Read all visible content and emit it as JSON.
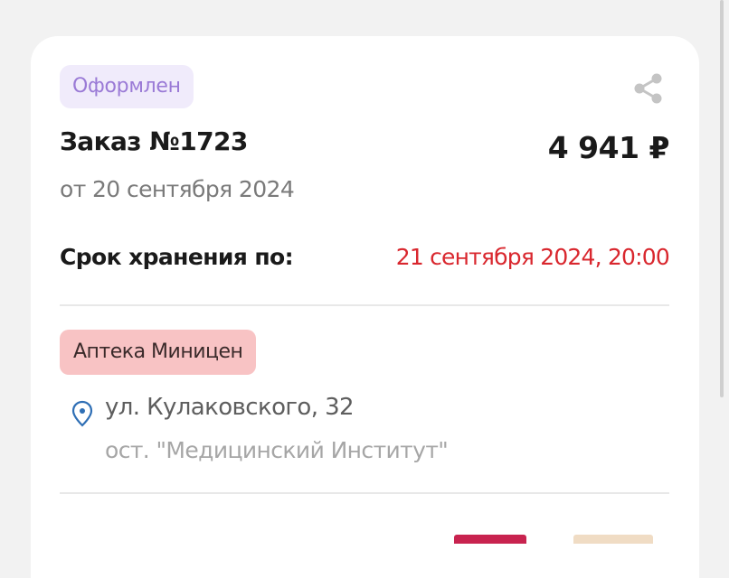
{
  "order": {
    "status": "Оформлен",
    "title": "Заказ №1723",
    "total": "4 941 ₽",
    "date": "от 20 сентября 2024",
    "storage_label": "Срок хранения по:",
    "storage_until": "21 сентября 2024, 20:00"
  },
  "pharmacy": {
    "name": "Аптека Миницен",
    "address": "ул. Кулаковского, 32",
    "stop": "ост. \"Медицинский Институт\""
  },
  "icons": {
    "share": "share-icon",
    "location": "location-pin-icon"
  },
  "colors": {
    "status_bg": "#f0ebfb",
    "status_text": "#9a7ad6",
    "pharmacy_bg": "#f8c3c4",
    "deadline_red": "#d9272e",
    "pin_blue": "#2f6fb5"
  }
}
